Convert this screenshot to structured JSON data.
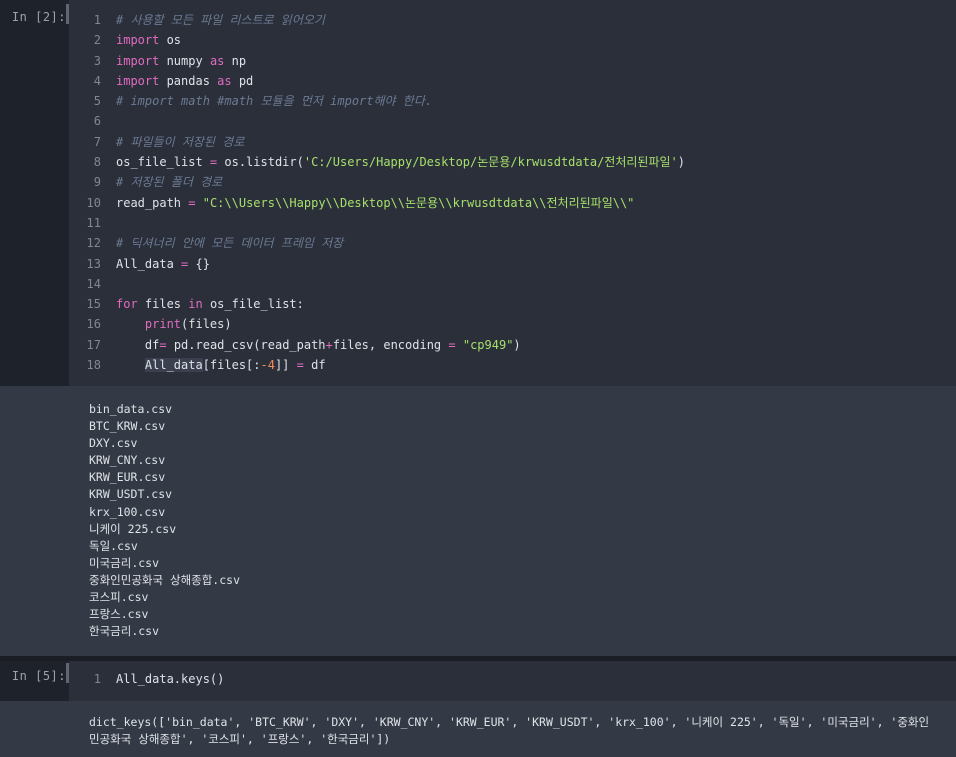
{
  "cells": [
    {
      "prompt": "In [2]:",
      "lines": [
        {
          "n": "1",
          "segs": [
            {
              "t": "# 사용할 모든 파일 리스트로 읽어오기",
              "c": "cm"
            }
          ]
        },
        {
          "n": "2",
          "segs": [
            {
              "t": "import",
              "c": "kw"
            },
            {
              "t": " os",
              "c": ""
            }
          ]
        },
        {
          "n": "3",
          "segs": [
            {
              "t": "import",
              "c": "kw"
            },
            {
              "t": " numpy ",
              "c": ""
            },
            {
              "t": "as",
              "c": "kw"
            },
            {
              "t": " np",
              "c": ""
            }
          ]
        },
        {
          "n": "4",
          "segs": [
            {
              "t": "import",
              "c": "kw"
            },
            {
              "t": " pandas ",
              "c": ""
            },
            {
              "t": "as",
              "c": "kw"
            },
            {
              "t": " pd",
              "c": ""
            }
          ]
        },
        {
          "n": "5",
          "segs": [
            {
              "t": "# import math #math 모듈을 먼저 import해야 한다.",
              "c": "cm"
            }
          ]
        },
        {
          "n": "6",
          "segs": []
        },
        {
          "n": "7",
          "segs": [
            {
              "t": "# 파일들이 저장된 경로",
              "c": "cm"
            }
          ]
        },
        {
          "n": "8",
          "segs": [
            {
              "t": "os_file_list ",
              "c": ""
            },
            {
              "t": "=",
              "c": "op"
            },
            {
              "t": " os.listdir(",
              "c": ""
            },
            {
              "t": "'C:/Users/Happy/Desktop/논문용/krwusdtdata/전처리된파일'",
              "c": "st"
            },
            {
              "t": ")",
              "c": ""
            }
          ]
        },
        {
          "n": "9",
          "segs": [
            {
              "t": "# 저장된 폴더 경로",
              "c": "cm"
            }
          ]
        },
        {
          "n": "10",
          "segs": [
            {
              "t": "read_path ",
              "c": ""
            },
            {
              "t": "=",
              "c": "op"
            },
            {
              "t": " ",
              "c": ""
            },
            {
              "t": "\"C:\\\\Users\\\\Happy\\\\Desktop\\\\논문용\\\\krwusdtdata\\\\전처리된파일\\\\\"",
              "c": "st"
            }
          ]
        },
        {
          "n": "11",
          "segs": []
        },
        {
          "n": "12",
          "segs": [
            {
              "t": "# 딕셔너리 안에 모든 데이터 프레임 저장",
              "c": "cm"
            }
          ]
        },
        {
          "n": "13",
          "segs": [
            {
              "t": "All_data ",
              "c": ""
            },
            {
              "t": "=",
              "c": "op"
            },
            {
              "t": " {}",
              "c": ""
            }
          ]
        },
        {
          "n": "14",
          "segs": []
        },
        {
          "n": "15",
          "segs": [
            {
              "t": "for",
              "c": "kw"
            },
            {
              "t": " files ",
              "c": ""
            },
            {
              "t": "in",
              "c": "kw"
            },
            {
              "t": " os_file_list:",
              "c": ""
            }
          ]
        },
        {
          "n": "16",
          "segs": [
            {
              "t": "    ",
              "c": ""
            },
            {
              "t": "print",
              "c": "kw"
            },
            {
              "t": "(files)",
              "c": ""
            }
          ]
        },
        {
          "n": "17",
          "segs": [
            {
              "t": "    df",
              "c": ""
            },
            {
              "t": "=",
              "c": "op"
            },
            {
              "t": " pd.read_csv(read_path",
              "c": ""
            },
            {
              "t": "+",
              "c": "op"
            },
            {
              "t": "files, encoding ",
              "c": ""
            },
            {
              "t": "=",
              "c": "op"
            },
            {
              "t": " ",
              "c": ""
            },
            {
              "t": "\"cp949\"",
              "c": "st"
            },
            {
              "t": ")",
              "c": ""
            }
          ]
        },
        {
          "n": "18",
          "segs": [
            {
              "t": "    ",
              "c": ""
            },
            {
              "t": "All_data",
              "c": "hl"
            },
            {
              "t": "[files[:",
              "c": ""
            },
            {
              "t": "-4",
              "c": "num"
            },
            {
              "t": "]] ",
              "c": ""
            },
            {
              "t": "=",
              "c": "op"
            },
            {
              "t": " df",
              "c": ""
            }
          ]
        }
      ],
      "output": [
        "bin_data.csv",
        "BTC_KRW.csv",
        "DXY.csv",
        "KRW_CNY.csv",
        "KRW_EUR.csv",
        "KRW_USDT.csv",
        "krx_100.csv",
        "니케이 225.csv",
        "독일.csv",
        "미국금리.csv",
        "중화인민공화국 상해종합.csv",
        "코스피.csv",
        "프랑스.csv",
        "한국금리.csv"
      ]
    },
    {
      "prompt": "In [5]:",
      "lines": [
        {
          "n": "1",
          "segs": [
            {
              "t": "All_data.keys()",
              "c": ""
            }
          ]
        }
      ],
      "output": [
        "dict_keys(['bin_data', 'BTC_KRW', 'DXY', 'KRW_CNY', 'KRW_EUR', 'KRW_USDT', 'krx_100', '니케이 225', '독일', '미국금리', '중화인",
        "민공화국 상해종합', '코스피', '프랑스', '한국금리'])"
      ]
    }
  ]
}
